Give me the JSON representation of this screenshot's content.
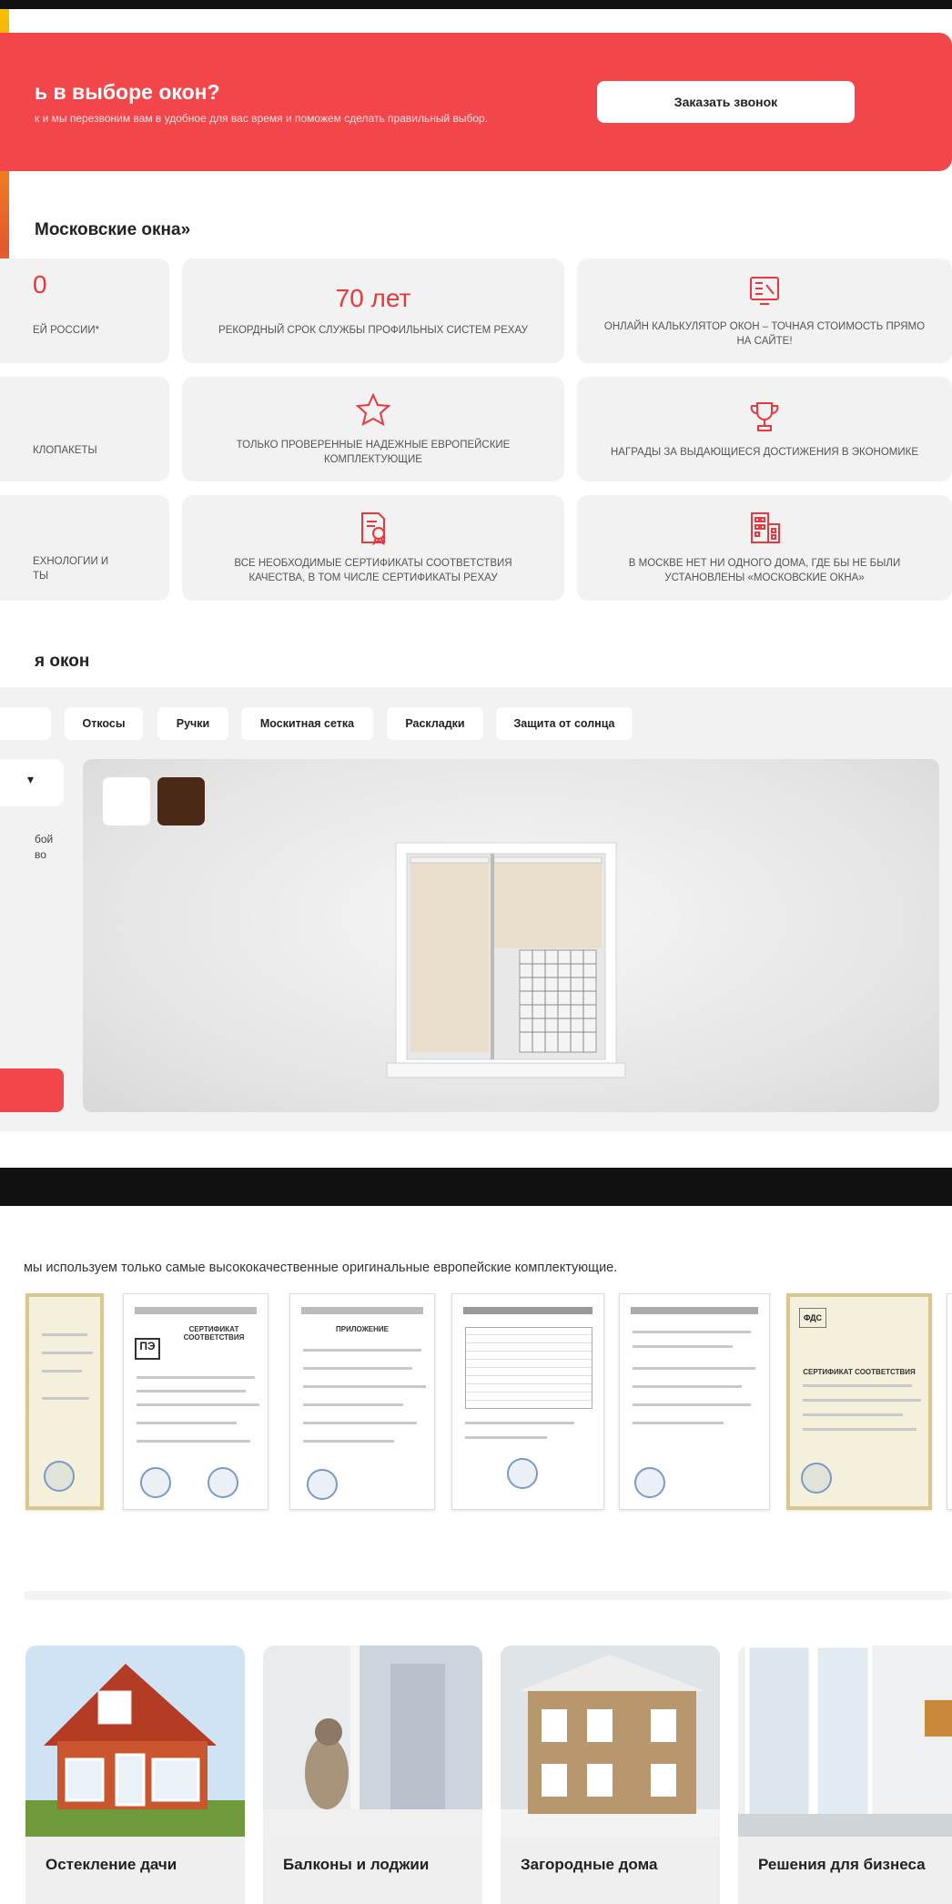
{
  "banner": {
    "title": "ь в выборе окон?",
    "subtitle": "к и мы перезвоним вам в удобное для вас время и поможем сделать правильный выбор.",
    "button_label": "Заказать звонок"
  },
  "advantages": {
    "title": "Московские окна»",
    "left_cards": [
      {
        "big": "0",
        "text": "ЕЙ РОССИИ*"
      },
      {
        "text": "КЛОПАКЕТЫ"
      },
      {
        "text": "ЕХНОЛОГИИ И\nТЫ"
      }
    ],
    "cards": [
      {
        "big": "70 лет",
        "text": "РЕКОРДНЫЙ СРОК СЛУЖБЫ ПРОФИЛЬНЫХ СИСТЕМ РЕХАУ",
        "icon": "calendar-icon"
      },
      {
        "text": "ОНЛАЙН КАЛЬКУЛЯТОР ОКОН – ТОЧНАЯ СТОИМОСТЬ ПРЯМО НА САЙТЕ!",
        "icon": "calculator-screen-icon"
      },
      {
        "text": "ТОЛЬКО ПРОВЕРЕННЫЕ НАДЕЖНЫЕ ЕВРОПЕЙСКИЕ КОМПЛЕКТУЮЩИЕ",
        "icon": "star-icon"
      },
      {
        "text": "НАГРАДЫ ЗА ВЫДАЮЩИЕСЯ ДОСТИЖЕНИЯ В ЭКОНОМИКЕ",
        "icon": "trophy-icon"
      },
      {
        "text": "ВСЕ НЕОБХОДИМЫЕ СЕРТИФИКАТЫ СООТВЕТСТВИЯ КАЧЕСТВА, В ТОМ ЧИСЛЕ СЕРТИФИКАТЫ РЕХАУ",
        "icon": "certificate-icon"
      },
      {
        "text": "В МОСКВЕ НЕТ НИ ОДНОГО ДОМА, ГДЕ БЫ НЕ БЫЛИ УСТАНОВЛЕНЫ «МОСКОВСКИЕ ОКНА»",
        "icon": "building-icon"
      }
    ]
  },
  "configurator": {
    "title": "я окон",
    "tabs": [
      "Откосы",
      "Ручки",
      "Москитная сетка",
      "Раскладки",
      "Защита от солнца"
    ],
    "side_text": "бой\nво",
    "swatches": [
      "#ffffff",
      "#4a2a17"
    ],
    "brand_color": "#f2464a"
  },
  "certificates": {
    "text": "мы используем только самые высококачественные оригинальные европейские комплектующие.",
    "items": [
      "СЕРТИФИКАТ СООТВЕТСТВИЯ",
      "ПРИЛОЖЕНИЕ",
      "",
      "",
      "СЕРТИФИКАТ СООТВЕТСТВИЯ"
    ]
  },
  "categories": [
    {
      "label": "Остекление дачи"
    },
    {
      "label": "Балконы и лоджии"
    },
    {
      "label": "Загородные дома"
    },
    {
      "label": "Решения для бизнеса"
    }
  ]
}
